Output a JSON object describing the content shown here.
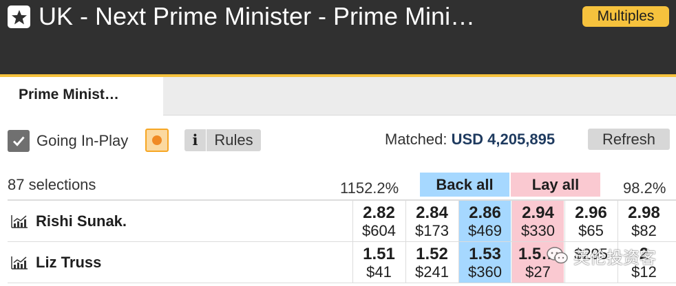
{
  "header": {
    "title": "UK - Next Prime Minister - Prime Mini…",
    "multiples_label": "Multiples",
    "star_icon": "star-icon"
  },
  "tabs": [
    {
      "label": "Prime Minist…",
      "active": true
    }
  ],
  "controls": {
    "going_inplay_label": "Going In-Play",
    "going_inplay_checked": true,
    "inplay_indicator_icon": "inplay-dot-icon",
    "info_icon_glyph": "i",
    "rules_label": "Rules",
    "matched_label": "Matched:",
    "matched_value": "USD 4,205,895",
    "refresh_label": "Refresh"
  },
  "market": {
    "selections_count": "87 selections",
    "back_percent": "1152.2%",
    "back_all_label": "Back all",
    "lay_all_label": "Lay all",
    "lay_percent": "98.2%"
  },
  "runners": [
    {
      "name": "Rishi Sunak.",
      "prices": [
        {
          "odds": "2.82",
          "size": "$604"
        },
        {
          "odds": "2.84",
          "size": "$173"
        },
        {
          "odds": "2.86",
          "size": "$469"
        },
        {
          "odds": "2.94",
          "size": "$330"
        },
        {
          "odds": "2.96",
          "size": "$65"
        },
        {
          "odds": "2.98",
          "size": "$82"
        }
      ]
    },
    {
      "name": "Liz Truss",
      "prices": [
        {
          "odds": "1.51",
          "size": "$41"
        },
        {
          "odds": "1.52",
          "size": "$241"
        },
        {
          "odds": "1.53",
          "size": "$360"
        },
        {
          "odds": "1.5…",
          "size": "$27"
        },
        {
          "odds": "",
          "size": "$295"
        },
        {
          "odds": "2",
          "size": "$12"
        }
      ]
    }
  ],
  "watermark": {
    "text": "英伦投资客"
  },
  "colors": {
    "header_bg": "#303030",
    "accent": "#f6c23d",
    "back_best": "#a6d8ff",
    "lay_best": "#fac9d1"
  }
}
